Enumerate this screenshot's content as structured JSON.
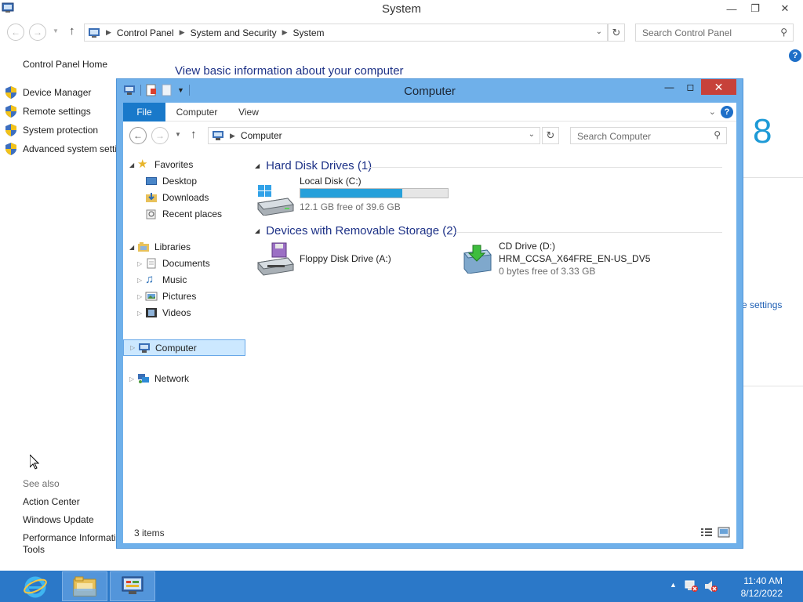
{
  "system_window": {
    "title": "System",
    "breadcrumb": [
      "Control Panel",
      "System and Security",
      "System"
    ],
    "search_placeholder": "Search Control Panel",
    "home_link": "Control Panel Home",
    "tasks": [
      "Device Manager",
      "Remote settings",
      "System protection",
      "Advanced system setti"
    ],
    "heading": "View basic information about your computer",
    "see_also_label": "See also",
    "see_also_links": [
      "Action Center",
      "Windows Update",
      "Performance Informati"
    ],
    "see_also_tools": "Tools",
    "peek_logo_text": "8",
    "peek_settings_text": "e settings"
  },
  "explorer": {
    "title": "Computer",
    "ribbon_tabs": [
      "File",
      "Computer",
      "View"
    ],
    "address": "Computer",
    "search_placeholder": "Search Computer",
    "nav": {
      "favorites": "Favorites",
      "favorites_items": [
        "Desktop",
        "Downloads",
        "Recent places"
      ],
      "libraries": "Libraries",
      "libraries_items": [
        "Documents",
        "Music",
        "Pictures",
        "Videos"
      ],
      "computer": "Computer",
      "network": "Network"
    },
    "groups": {
      "hdd_header": "Hard Disk Drives (1)",
      "removable_header": "Devices with Removable Storage (2)"
    },
    "drives": {
      "c_name": "Local Disk (C:)",
      "c_free": "12.1 GB free of 39.6 GB",
      "c_used_fraction": 0.694,
      "a_name": "Floppy Disk Drive (A:)",
      "d_name": "CD Drive (D:)",
      "d_label": "HRM_CCSA_X64FRE_EN-US_DV5",
      "d_free": "0 bytes free of 3.33 GB"
    },
    "status": "3 items"
  },
  "taskbar": {
    "time": "11:40 AM",
    "date": "8/12/2022"
  },
  "colors": {
    "accent": "#1979ca",
    "window_frame": "#6fb0ea",
    "taskbar": "#2b78c8",
    "link": "#1e3287",
    "progress": "#26a0da"
  }
}
